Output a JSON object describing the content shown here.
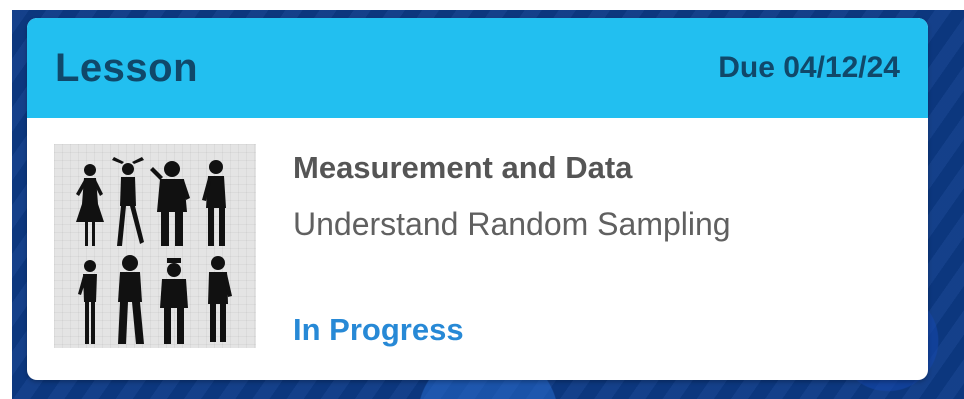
{
  "card": {
    "type_label": "Lesson",
    "due_label": "Due 04/12/24",
    "title": "Measurement and Data",
    "subtitle": "Understand Random Sampling",
    "status": "In Progress"
  },
  "colors": {
    "header_bg": "#22bff0",
    "header_text": "#10486a",
    "status_text": "#2789d6",
    "backdrop": "#0d3a86"
  },
  "icons": {
    "thumbnail": "people-silhouettes-image"
  }
}
